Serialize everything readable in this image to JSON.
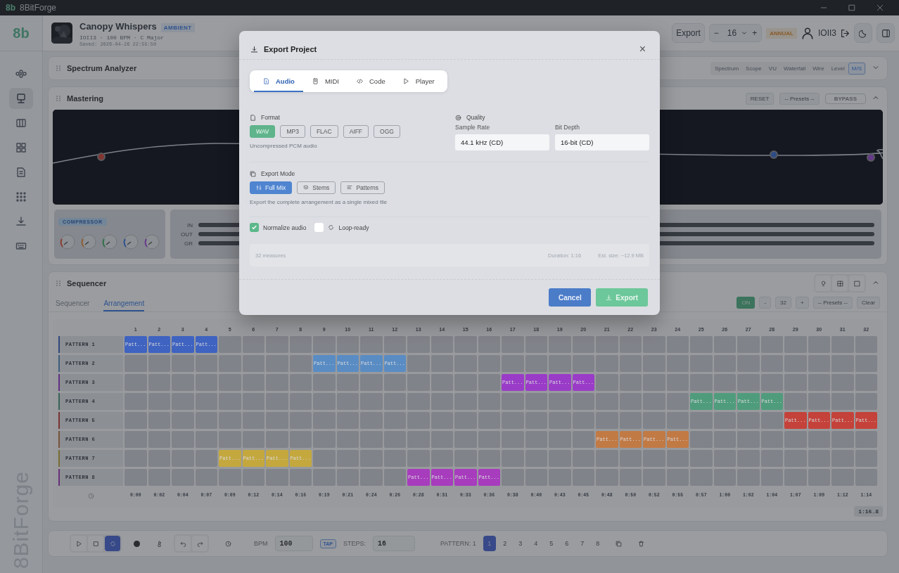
{
  "window": {
    "logo": "8b",
    "title": "8BitForge",
    "controls": [
      {
        "kind": "minimize"
      },
      {
        "kind": "maximize"
      },
      {
        "kind": "close"
      }
    ]
  },
  "sidebar": {
    "logo": "8b",
    "brand": "8BitForge",
    "items": [
      {
        "kind": "nodes",
        "selected": false
      },
      {
        "kind": "monitor",
        "selected": true
      },
      {
        "kind": "piano",
        "selected": false
      },
      {
        "kind": "grid",
        "selected": false
      },
      {
        "kind": "book",
        "selected": false
      },
      {
        "kind": "dots",
        "selected": false
      },
      {
        "kind": "download",
        "selected": false
      },
      {
        "kind": "keyboard",
        "selected": false
      }
    ]
  },
  "project": {
    "title": "Canopy Whispers",
    "genre": "AMBIENT",
    "meta": "IOII3 · 100 BPM · C Major",
    "saved": "Saved: 2026-04-26 22:55:50"
  },
  "toolbar": {
    "export": "Export",
    "zoom": {
      "minus": "−",
      "value": "16",
      "plus": "+"
    },
    "plan": "ANNUAL",
    "user": "IOII3"
  },
  "spectrum": {
    "title": "Spectrum Analyzer",
    "views": [
      {
        "label": "Spectrum",
        "selected": false
      },
      {
        "label": "Scope",
        "selected": false
      },
      {
        "label": "VU",
        "selected": false
      },
      {
        "label": "Waterfall",
        "selected": false
      },
      {
        "label": "Wire",
        "selected": false
      },
      {
        "label": "Level",
        "selected": false
      },
      {
        "label": "M/S",
        "selected": true
      }
    ]
  },
  "mastering": {
    "title": "Mastering",
    "reset": "RESET",
    "presets": "-- Presets --",
    "bypass": "BYPASS",
    "compressor": "COMPRESSOR",
    "meters": [
      {
        "label": "IN"
      },
      {
        "label": "OUT"
      },
      {
        "label": "GR"
      }
    ]
  },
  "sequencer": {
    "title": "Sequencer",
    "tabs": [
      {
        "label": "Sequencer",
        "selected": false
      },
      {
        "label": "Arrangement",
        "selected": true
      }
    ],
    "controls": {
      "on": "ON",
      "minus": "-",
      "length": "32",
      "plus": "+",
      "presets": "-- Presets --",
      "clear": "Clear"
    },
    "columns": [
      "1",
      "2",
      "3",
      "4",
      "5",
      "6",
      "7",
      "8",
      "9",
      "10",
      "11",
      "12",
      "13",
      "14",
      "15",
      "16",
      "17",
      "18",
      "19",
      "20",
      "21",
      "22",
      "23",
      "24",
      "25",
      "26",
      "27",
      "28",
      "29",
      "30",
      "31",
      "32"
    ],
    "rows": [
      {
        "name": "PATTERN 1",
        "color": "#3f63c0",
        "cells": [
          {
            "filled": true,
            "label": "Patt..."
          },
          {
            "filled": true,
            "label": "Patt..."
          },
          {
            "filled": true,
            "label": "Patt..."
          },
          {
            "filled": true,
            "label": "Patt..."
          },
          {
            "filled": false
          },
          {
            "filled": false
          },
          {
            "filled": false
          },
          {
            "filled": false
          },
          {
            "filled": false
          },
          {
            "filled": false
          },
          {
            "filled": false
          },
          {
            "filled": false
          },
          {
            "filled": false
          },
          {
            "filled": false
          },
          {
            "filled": false
          },
          {
            "filled": false
          },
          {
            "filled": false
          },
          {
            "filled": false
          },
          {
            "filled": false
          },
          {
            "filled": false
          },
          {
            "filled": false
          },
          {
            "filled": false
          },
          {
            "filled": false
          },
          {
            "filled": false
          },
          {
            "filled": false
          },
          {
            "filled": false
          },
          {
            "filled": false
          },
          {
            "filled": false
          },
          {
            "filled": false
          },
          {
            "filled": false
          },
          {
            "filled": false
          },
          {
            "filled": false
          }
        ]
      },
      {
        "name": "PATTERN 2",
        "color": "#5a8cc4",
        "cells": [
          {
            "filled": false
          },
          {
            "filled": false
          },
          {
            "filled": false
          },
          {
            "filled": false
          },
          {
            "filled": false
          },
          {
            "filled": false
          },
          {
            "filled": false
          },
          {
            "filled": false
          },
          {
            "filled": true,
            "label": "Patt..."
          },
          {
            "filled": true,
            "label": "Patt..."
          },
          {
            "filled": true,
            "label": "Patt..."
          },
          {
            "filled": true,
            "label": "Patt..."
          },
          {
            "filled": false
          },
          {
            "filled": false
          },
          {
            "filled": false
          },
          {
            "filled": false
          },
          {
            "filled": false
          },
          {
            "filled": false
          },
          {
            "filled": false
          },
          {
            "filled": false
          },
          {
            "filled": false
          },
          {
            "filled": false
          },
          {
            "filled": false
          },
          {
            "filled": false
          },
          {
            "filled": false
          },
          {
            "filled": false
          },
          {
            "filled": false
          },
          {
            "filled": false
          },
          {
            "filled": false
          },
          {
            "filled": false
          },
          {
            "filled": false
          },
          {
            "filled": false
          }
        ]
      },
      {
        "name": "PATTERN 3",
        "color": "#9a3cc8",
        "cells": [
          {
            "filled": false
          },
          {
            "filled": false
          },
          {
            "filled": false
          },
          {
            "filled": false
          },
          {
            "filled": false
          },
          {
            "filled": false
          },
          {
            "filled": false
          },
          {
            "filled": false
          },
          {
            "filled": false
          },
          {
            "filled": false
          },
          {
            "filled": false
          },
          {
            "filled": false
          },
          {
            "filled": false
          },
          {
            "filled": false
          },
          {
            "filled": false
          },
          {
            "filled": false
          },
          {
            "filled": true,
            "label": "Patt..."
          },
          {
            "filled": true,
            "label": "Patt..."
          },
          {
            "filled": true,
            "label": "Patt..."
          },
          {
            "filled": true,
            "label": "Patt..."
          },
          {
            "filled": false
          },
          {
            "filled": false
          },
          {
            "filled": false
          },
          {
            "filled": false
          },
          {
            "filled": false
          },
          {
            "filled": false
          },
          {
            "filled": false
          },
          {
            "filled": false
          },
          {
            "filled": false
          },
          {
            "filled": false
          },
          {
            "filled": false
          },
          {
            "filled": false
          }
        ]
      },
      {
        "name": "PATTERN 4",
        "color": "#4f9c7c",
        "cells": [
          {
            "filled": false
          },
          {
            "filled": false
          },
          {
            "filled": false
          },
          {
            "filled": false
          },
          {
            "filled": false
          },
          {
            "filled": false
          },
          {
            "filled": false
          },
          {
            "filled": false
          },
          {
            "filled": false
          },
          {
            "filled": false
          },
          {
            "filled": false
          },
          {
            "filled": false
          },
          {
            "filled": false
          },
          {
            "filled": false
          },
          {
            "filled": false
          },
          {
            "filled": false
          },
          {
            "filled": false
          },
          {
            "filled": false
          },
          {
            "filled": false
          },
          {
            "filled": false
          },
          {
            "filled": false
          },
          {
            "filled": false
          },
          {
            "filled": false
          },
          {
            "filled": false
          },
          {
            "filled": true,
            "label": "Patt..."
          },
          {
            "filled": true,
            "label": "Patt..."
          },
          {
            "filled": true,
            "label": "Patt..."
          },
          {
            "filled": true,
            "label": "Patt..."
          },
          {
            "filled": false
          },
          {
            "filled": false
          },
          {
            "filled": false
          },
          {
            "filled": false
          }
        ]
      },
      {
        "name": "PATTERN 5",
        "color": "#c4423a",
        "cells": [
          {
            "filled": false
          },
          {
            "filled": false
          },
          {
            "filled": false
          },
          {
            "filled": false
          },
          {
            "filled": false
          },
          {
            "filled": false
          },
          {
            "filled": false
          },
          {
            "filled": false
          },
          {
            "filled": false
          },
          {
            "filled": false
          },
          {
            "filled": false
          },
          {
            "filled": false
          },
          {
            "filled": false
          },
          {
            "filled": false
          },
          {
            "filled": false
          },
          {
            "filled": false
          },
          {
            "filled": false
          },
          {
            "filled": false
          },
          {
            "filled": false
          },
          {
            "filled": false
          },
          {
            "filled": false
          },
          {
            "filled": false
          },
          {
            "filled": false
          },
          {
            "filled": false
          },
          {
            "filled": false
          },
          {
            "filled": false
          },
          {
            "filled": false
          },
          {
            "filled": false
          },
          {
            "filled": true,
            "label": "Patt..."
          },
          {
            "filled": true,
            "label": "Patt..."
          },
          {
            "filled": true,
            "label": "Patt..."
          },
          {
            "filled": true,
            "label": "Patt..."
          }
        ]
      },
      {
        "name": "PATTERN 6",
        "color": "#c27a45",
        "cells": [
          {
            "filled": false
          },
          {
            "filled": false
          },
          {
            "filled": false
          },
          {
            "filled": false
          },
          {
            "filled": false
          },
          {
            "filled": false
          },
          {
            "filled": false
          },
          {
            "filled": false
          },
          {
            "filled": false
          },
          {
            "filled": false
          },
          {
            "filled": false
          },
          {
            "filled": false
          },
          {
            "filled": false
          },
          {
            "filled": false
          },
          {
            "filled": false
          },
          {
            "filled": false
          },
          {
            "filled": false
          },
          {
            "filled": false
          },
          {
            "filled": false
          },
          {
            "filled": false
          },
          {
            "filled": true,
            "label": "Patt..."
          },
          {
            "filled": true,
            "label": "Patt..."
          },
          {
            "filled": true,
            "label": "Patt..."
          },
          {
            "filled": true,
            "label": "Patt..."
          },
          {
            "filled": false
          },
          {
            "filled": false
          },
          {
            "filled": false
          },
          {
            "filled": false
          },
          {
            "filled": false
          },
          {
            "filled": false
          },
          {
            "filled": false
          },
          {
            "filled": false
          }
        ]
      },
      {
        "name": "PATTERN 7",
        "color": "#c4a83e",
        "cells": [
          {
            "filled": false
          },
          {
            "filled": false
          },
          {
            "filled": false
          },
          {
            "filled": false
          },
          {
            "filled": true,
            "label": "Patt..."
          },
          {
            "filled": true,
            "label": "Patt..."
          },
          {
            "filled": true,
            "label": "Patt..."
          },
          {
            "filled": true,
            "label": "Patt..."
          },
          {
            "filled": false
          },
          {
            "filled": false
          },
          {
            "filled": false
          },
          {
            "filled": false
          },
          {
            "filled": false
          },
          {
            "filled": false
          },
          {
            "filled": false
          },
          {
            "filled": false
          },
          {
            "filled": false
          },
          {
            "filled": false
          },
          {
            "filled": false
          },
          {
            "filled": false
          },
          {
            "filled": false
          },
          {
            "filled": false
          },
          {
            "filled": false
          },
          {
            "filled": false
          },
          {
            "filled": false
          },
          {
            "filled": false
          },
          {
            "filled": false
          },
          {
            "filled": false
          },
          {
            "filled": false
          },
          {
            "filled": false
          },
          {
            "filled": false
          },
          {
            "filled": false
          }
        ]
      },
      {
        "name": "PATTERN 8",
        "color": "#a73cbd",
        "cells": [
          {
            "filled": false
          },
          {
            "filled": false
          },
          {
            "filled": false
          },
          {
            "filled": false
          },
          {
            "filled": false
          },
          {
            "filled": false
          },
          {
            "filled": false
          },
          {
            "filled": false
          },
          {
            "filled": false
          },
          {
            "filled": false
          },
          {
            "filled": false
          },
          {
            "filled": false
          },
          {
            "filled": true,
            "label": "Patt..."
          },
          {
            "filled": true,
            "label": "Patt..."
          },
          {
            "filled": true,
            "label": "Patt..."
          },
          {
            "filled": true,
            "label": "Patt..."
          },
          {
            "filled": false
          },
          {
            "filled": false
          },
          {
            "filled": false
          },
          {
            "filled": false
          },
          {
            "filled": false
          },
          {
            "filled": false
          },
          {
            "filled": false
          },
          {
            "filled": false
          },
          {
            "filled": false
          },
          {
            "filled": false
          },
          {
            "filled": false
          },
          {
            "filled": false
          },
          {
            "filled": false
          },
          {
            "filled": false
          },
          {
            "filled": false
          },
          {
            "filled": false
          }
        ]
      }
    ],
    "times": [
      "0:00",
      "0:02",
      "0:04",
      "0:07",
      "0:09",
      "0:12",
      "0:14",
      "0:16",
      "0:19",
      "0:21",
      "0:24",
      "0:26",
      "0:28",
      "0:31",
      "0:33",
      "0:36",
      "0:38",
      "0:40",
      "0:43",
      "0:45",
      "0:48",
      "0:50",
      "0:52",
      "0:55",
      "0:57",
      "1:00",
      "1:02",
      "1:04",
      "1:07",
      "1:09",
      "1:12",
      "1:14"
    ],
    "total": "1:16.8"
  },
  "transport": {
    "bpm_label": "BPM",
    "bpm": "100",
    "tap": "TAP",
    "steps_label": "STEPS:",
    "steps": "16",
    "pattern_label": "PATTERN: 1",
    "patterns": [
      {
        "label": "1",
        "selected": true
      },
      {
        "label": "2",
        "selected": false
      },
      {
        "label": "3",
        "selected": false
      },
      {
        "label": "4",
        "selected": false
      },
      {
        "label": "5",
        "selected": false
      },
      {
        "label": "6",
        "selected": false
      },
      {
        "label": "7",
        "selected": false
      },
      {
        "label": "8",
        "selected": false
      }
    ]
  },
  "export_dialog": {
    "title": "Export Project",
    "close": "×",
    "tabs": [
      {
        "label": "Audio",
        "kind": "audio",
        "selected": true
      },
      {
        "label": "MIDI",
        "kind": "midi",
        "selected": false
      },
      {
        "label": "Code",
        "kind": "code",
        "selected": false
      },
      {
        "label": "Player",
        "kind": "player",
        "selected": false
      }
    ],
    "format": {
      "label": "Format",
      "options": [
        {
          "label": "WAV",
          "selected": true
        },
        {
          "label": "MP3",
          "selected": false
        },
        {
          "label": "FLAC",
          "selected": false
        },
        {
          "label": "AIFF",
          "selected": false
        },
        {
          "label": "OGG",
          "selected": false
        }
      ],
      "hint": "Uncompressed PCM audio"
    },
    "quality": {
      "label": "Quality",
      "sample_rate": {
        "label": "Sample Rate",
        "value": "44.1 kHz (CD)"
      },
      "bit_depth": {
        "label": "Bit Depth",
        "value": "16-bit (CD)"
      }
    },
    "mode": {
      "label": "Export Mode",
      "options": [
        {
          "label": "Full Mix",
          "kind": "mix",
          "selected": true
        },
        {
          "label": "Stems",
          "kind": "stems",
          "selected": false
        },
        {
          "label": "Patterns",
          "kind": "patterns",
          "selected": false
        }
      ],
      "hint": "Export the complete arrangement as a single mixed file"
    },
    "options": [
      {
        "label": "Normalize audio",
        "kind": "plain",
        "checked": true
      },
      {
        "label": "Loop-ready",
        "kind": "loop",
        "checked": false
      }
    ],
    "summary": {
      "measures": "32 measures",
      "duration": "Duration: 1:16",
      "size": "Est. size: ~12.9 MB"
    },
    "cancel": "Cancel",
    "export": "Export"
  }
}
